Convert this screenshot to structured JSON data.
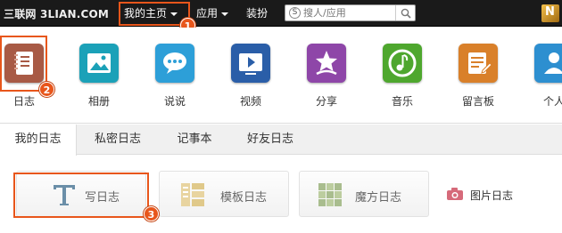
{
  "topbar": {
    "brand": "三联网 3LIAN.COM",
    "home_label": "我的主页",
    "apps_label": "应用",
    "decor_label": "装扮",
    "search_placeholder": "搜人/应用"
  },
  "apps": [
    {
      "label": "日志",
      "color": "#a85a45"
    },
    {
      "label": "相册",
      "color": "#1ba1b8"
    },
    {
      "label": "说说",
      "color": "#2d9fd8"
    },
    {
      "label": "视频",
      "color": "#2a5ea8"
    },
    {
      "label": "分享",
      "color": "#8e46a8"
    },
    {
      "label": "音乐",
      "color": "#4ea72e"
    },
    {
      "label": "留言板",
      "color": "#d9802a"
    },
    {
      "label": "个人",
      "color": "#2d8fd0"
    }
  ],
  "tabs": [
    "我的日志",
    "私密日志",
    "记事本",
    "好友日志"
  ],
  "write": {
    "write_label": "写日志",
    "template_label": "模板日志",
    "magic_label": "魔方日志",
    "picture_label": "图片日志"
  },
  "badges": [
    "1",
    "2",
    "3"
  ],
  "colors": {
    "accent": "#e8561b",
    "topbar": "#1a1a1a"
  }
}
